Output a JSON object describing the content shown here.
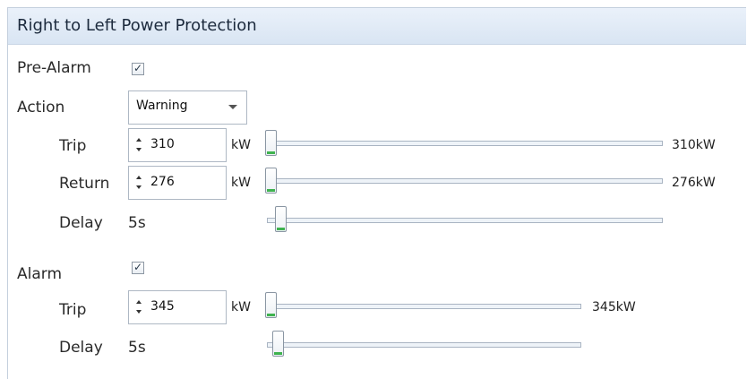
{
  "header": {
    "title": "Right to Left Power Protection"
  },
  "pre_alarm": {
    "label": "Pre-Alarm",
    "checked": true,
    "action": {
      "label": "Action",
      "value": "Warning"
    },
    "trip": {
      "label": "Trip",
      "value": "310",
      "unit": "kW",
      "readout": "310kW"
    },
    "return": {
      "label": "Return",
      "value": "276",
      "unit": "kW",
      "readout": "276kW"
    },
    "delay": {
      "label": "Delay",
      "value": "5s"
    }
  },
  "alarm": {
    "label": "Alarm",
    "checked": true,
    "trip": {
      "label": "Trip",
      "value": "345",
      "unit": "kW",
      "readout": "345kW"
    },
    "delay": {
      "label": "Delay",
      "value": "5s"
    }
  },
  "colors": {
    "header_bg": "#dfe9f5",
    "slider_grip": "#3fb34f"
  },
  "icons": {
    "checkbox_mark": "check-icon",
    "combo": "chevron-down-icon",
    "spin": "spin-arrows-icon"
  }
}
